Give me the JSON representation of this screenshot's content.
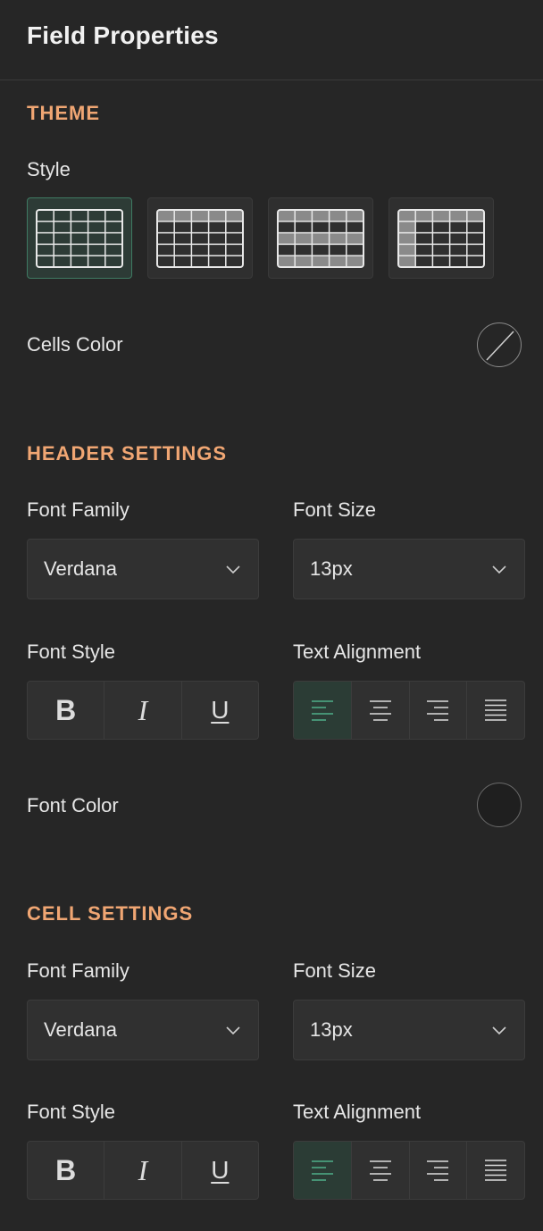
{
  "panel": {
    "title": "Field Properties"
  },
  "theme": {
    "section_title": "THEME",
    "style_label": "Style",
    "styles": [
      {
        "name": "plain-grid",
        "selected": true
      },
      {
        "name": "header-shaded",
        "selected": false
      },
      {
        "name": "striped-rows",
        "selected": false
      },
      {
        "name": "header-and-column-shaded",
        "selected": false
      }
    ],
    "cells_color_label": "Cells Color",
    "cells_color": "none"
  },
  "header_settings": {
    "section_title": "HEADER SETTINGS",
    "font_family_label": "Font Family",
    "font_family_value": "Verdana",
    "font_size_label": "Font Size",
    "font_size_value": "13px",
    "font_style_label": "Font Style",
    "text_alignment_label": "Text Alignment",
    "alignment_selected": "left",
    "font_color_label": "Font Color",
    "font_color": "#1f1f1f"
  },
  "cell_settings": {
    "section_title": "CELL SETTINGS",
    "font_family_label": "Font Family",
    "font_family_value": "Verdana",
    "font_size_label": "Font Size",
    "font_size_value": "13px",
    "font_style_label": "Font Style",
    "text_alignment_label": "Text Alignment",
    "alignment_selected": "left"
  },
  "font_style_buttons": {
    "bold": "B",
    "italic": "I",
    "underline": "U"
  },
  "colors": {
    "accent": "#f0a673",
    "selected": "#3f7b63",
    "active_icon": "#4fae8a"
  }
}
